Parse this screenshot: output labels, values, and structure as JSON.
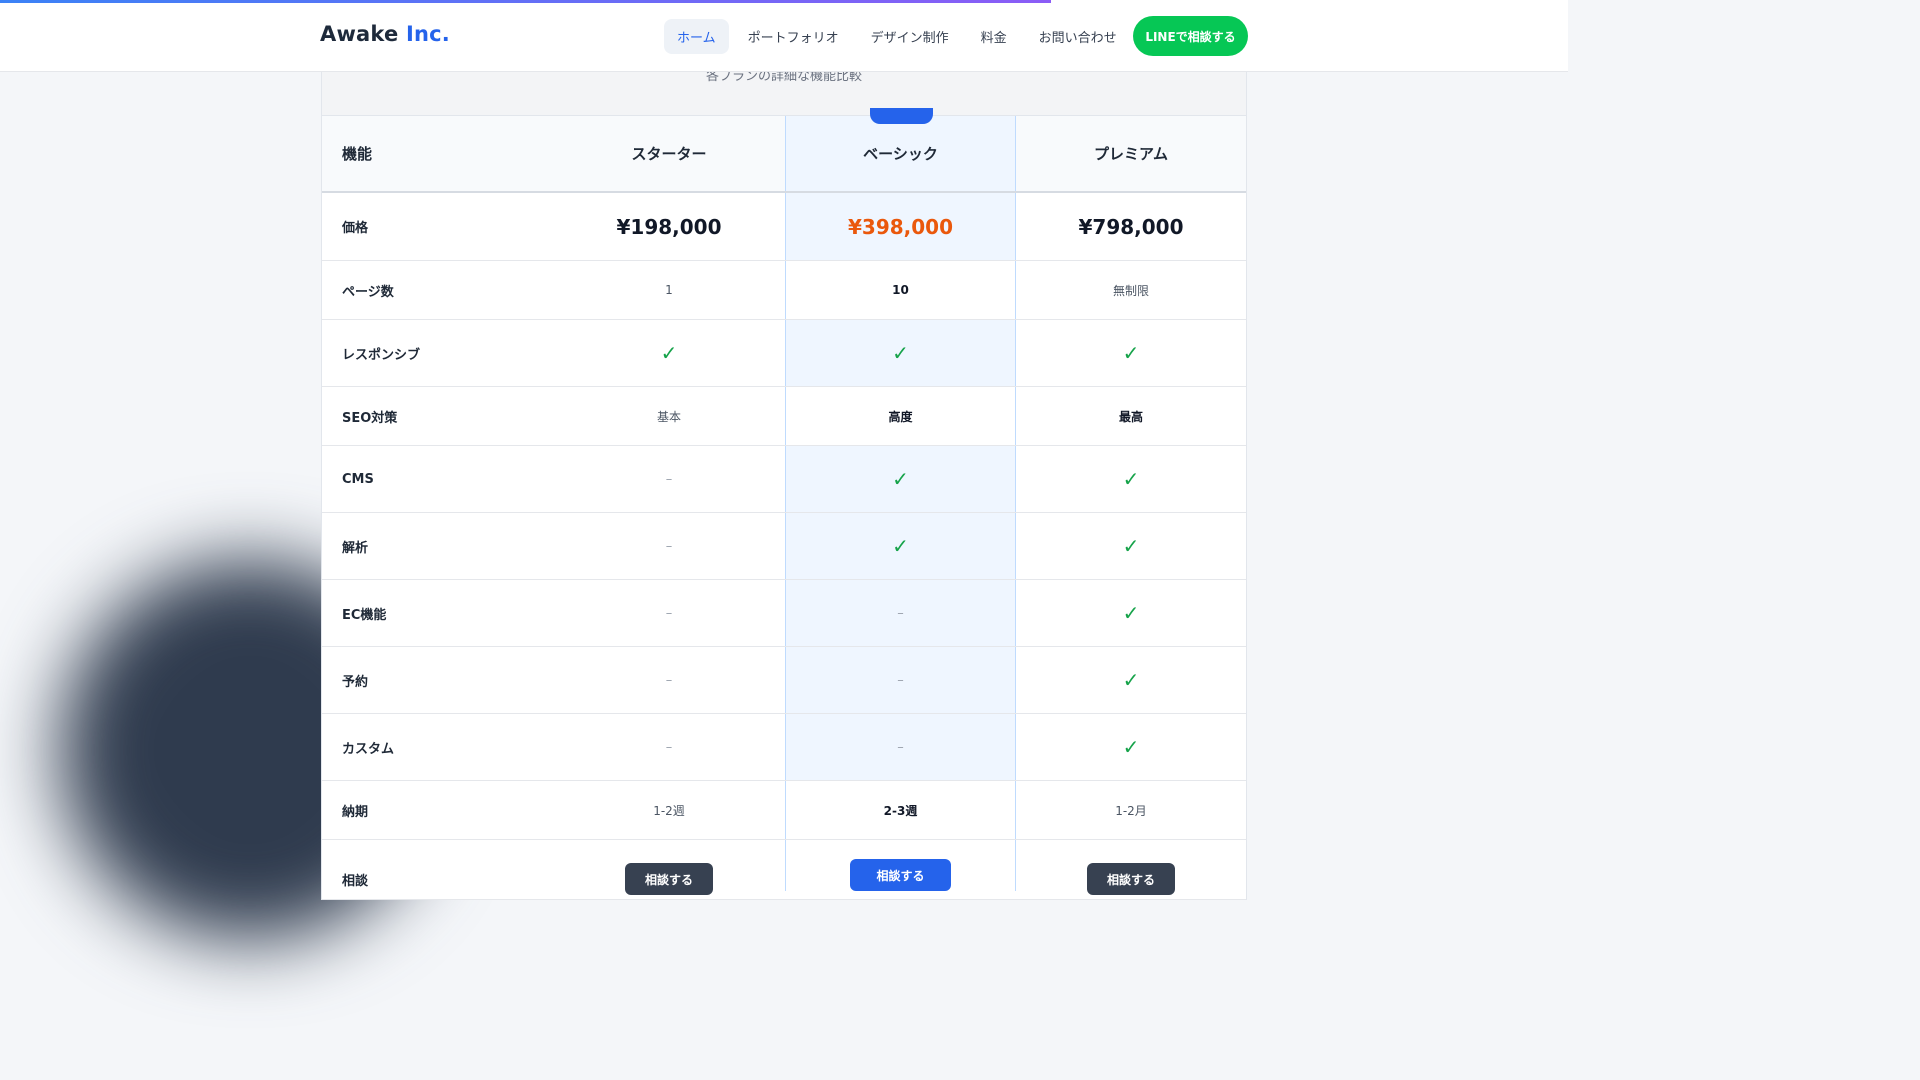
{
  "progress_percent": 67,
  "header": {
    "logo_main": "Awake",
    "logo_accent": "Inc.",
    "nav": [
      "ホーム",
      "ポートフォリオ",
      "デザイン制作",
      "料金",
      "お問い合わせ"
    ],
    "active_nav": "ホーム",
    "cta": "LINEで相談する",
    "cta_color": "#06c755"
  },
  "comparison": {
    "subtitle": "各プランの詳細な機能比較",
    "columns": [
      "機能",
      "スターター",
      "ベーシック",
      "プレミアム"
    ],
    "prices": {
      "label": "価格",
      "values": [
        "¥198,000",
        "¥398,000",
        "¥798,000"
      ]
    },
    "pages": {
      "label": "ページ数",
      "values": [
        "1",
        "10",
        "無制限"
      ]
    },
    "responsive": {
      "label": "レスポンシブ"
    },
    "seo": {
      "label": "SEO対策",
      "values": [
        "基本",
        "高度",
        "最高"
      ]
    },
    "cms": {
      "label": "CMS"
    },
    "analytics": {
      "label": "解析"
    },
    "ec": {
      "label": "EC機能"
    },
    "booking": {
      "label": "予約"
    },
    "custom": {
      "label": "カスタム"
    },
    "delivery": {
      "label": "納期",
      "values": [
        "1-2週",
        "2-3週",
        "1-2月"
      ]
    },
    "consult": {
      "label": "相談",
      "button": "相談する"
    },
    "check_symbol": "✓",
    "dash_symbol": "–",
    "highlight_price_color": "#ea580c",
    "check_color": "#16a34a"
  }
}
